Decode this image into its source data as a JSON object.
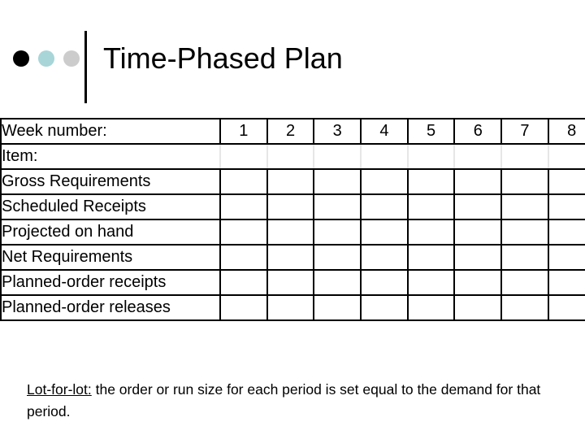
{
  "slide": {
    "title": "Time-Phased Plan",
    "decorative_dots": [
      {
        "name": "dot-black",
        "color": "#000000"
      },
      {
        "name": "dot-teal",
        "color": "#a8d5d8"
      },
      {
        "name": "dot-gray",
        "color": "#cccccc"
      }
    ]
  },
  "table": {
    "week_label": "Week number:",
    "week_numbers": [
      "1",
      "2",
      "3",
      "4",
      "5",
      "6",
      "7",
      "8"
    ],
    "rows": [
      {
        "label": "Item:",
        "values": [
          "",
          "",
          "",
          "",
          "",
          "",
          "",
          ""
        ]
      },
      {
        "label": "Gross Requirements",
        "values": [
          "",
          "",
          "",
          "",
          "",
          "",
          "",
          ""
        ]
      },
      {
        "label": "Scheduled Receipts",
        "values": [
          "",
          "",
          "",
          "",
          "",
          "",
          "",
          ""
        ]
      },
      {
        "label": "Projected on hand",
        "values": [
          "",
          "",
          "",
          "",
          "",
          "",
          "",
          ""
        ]
      },
      {
        "label": "Net Requirements",
        "values": [
          "",
          "",
          "",
          "",
          "",
          "",
          "",
          ""
        ]
      },
      {
        "label": "Planned-order receipts",
        "values": [
          "",
          "",
          "",
          "",
          "",
          "",
          "",
          ""
        ]
      },
      {
        "label": "Planned-order releases",
        "values": [
          "",
          "",
          "",
          "",
          "",
          "",
          "",
          ""
        ]
      }
    ]
  },
  "caption": {
    "term": "Lot-for-lot:",
    "text": " the order or run size for each period is set equal to the demand for that period."
  }
}
